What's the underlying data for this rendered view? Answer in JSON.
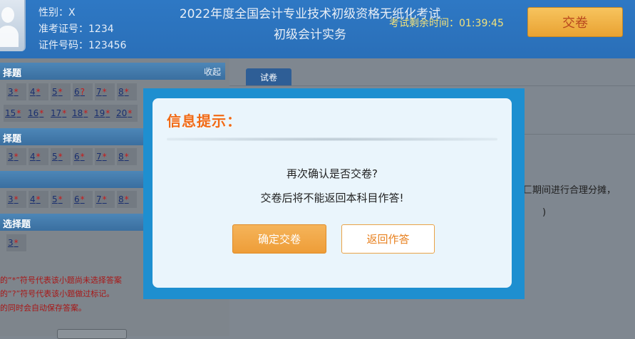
{
  "candidate": {
    "gender": "性别：X",
    "exam_no": "准考证号：1234",
    "id_no": "证件号码：123456"
  },
  "exam": {
    "title": "2022年度全国会计专业技术初级资格无纸化考试",
    "subject": "初级会计实务",
    "timer": "考试剩余时间：01:39:45",
    "submit_label": "交卷"
  },
  "sections": [
    {
      "title": "择题",
      "collapse": "收起",
      "rows": [
        [
          {
            "n": "3",
            "m": "*"
          },
          {
            "n": "4",
            "m": "*"
          },
          {
            "n": "5",
            "m": "*"
          },
          {
            "n": "6",
            "m": "?"
          },
          {
            "n": "7",
            "m": "*"
          },
          {
            "n": "8",
            "m": "*"
          }
        ],
        [
          {
            "n": "15",
            "m": "*"
          },
          {
            "n": "16",
            "m": "*"
          },
          {
            "n": "17",
            "m": "*"
          },
          {
            "n": "18",
            "m": "*"
          },
          {
            "n": "19",
            "m": "*"
          },
          {
            "n": "20",
            "m": "*"
          }
        ]
      ]
    },
    {
      "title": "择题",
      "rows": [
        [
          {
            "n": "3",
            "m": "*"
          },
          {
            "n": "4",
            "m": "*"
          },
          {
            "n": "5",
            "m": "*"
          },
          {
            "n": "6",
            "m": "*"
          },
          {
            "n": "7",
            "m": "*"
          },
          {
            "n": "8",
            "m": "*"
          }
        ]
      ]
    },
    {
      "title": "",
      "rows": [
        [
          {
            "n": "3",
            "m": "*"
          },
          {
            "n": "4",
            "m": "*"
          },
          {
            "n": "5",
            "m": "*"
          },
          {
            "n": "6",
            "m": "*"
          },
          {
            "n": "7",
            "m": "*"
          },
          {
            "n": "8",
            "m": "*"
          }
        ]
      ]
    },
    {
      "title": "选择题",
      "rows": [
        [
          {
            "n": "3",
            "m": "*"
          }
        ]
      ]
    }
  ],
  "legend": [
    "的“*”符号代表该小题尚未选择答案",
    "的“?”符号代表该小题做过标记。",
    "的同时会自动保存答案。"
  ],
  "right": {
    "tab": "试卷",
    "text1": "匚期间进行合理分摊，",
    "text2": ")"
  },
  "modal": {
    "title": "信息提示：",
    "line1": "再次确认是否交卷?",
    "line2": "交卷后将不能返回本科目作答!",
    "confirm_label": "确定交卷",
    "back_label": "返回作答"
  }
}
